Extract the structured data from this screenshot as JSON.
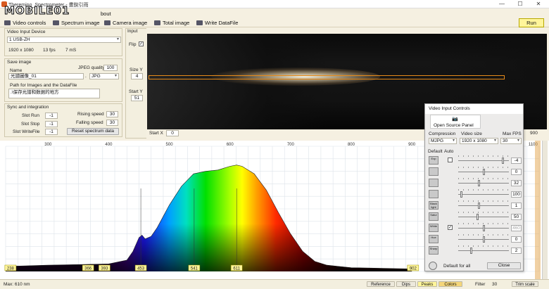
{
  "window": {
    "title": "Theremino_Spectrometer - 畫銳引雨",
    "logo": "MOBILE01",
    "menu_partial": "bout",
    "min": "—",
    "max": "☐",
    "close": "✕"
  },
  "toolbar": {
    "video_controls": "Video controls",
    "spectrum_image": "Spectrum image",
    "camera_image": "Camera image",
    "total_image": "Total image",
    "write_datafile": "Write DataFile",
    "run": "Run"
  },
  "video_input_device": {
    "header": "Video Input Device",
    "device": "1 USB-ZH",
    "resolution": "1920 x 1080",
    "fps": "13 fps",
    "ms": "7 mS"
  },
  "save_image": {
    "header": "Save image",
    "name_label": "Name",
    "jpeg_quality_label": "JPEG quality",
    "jpeg_quality": "100",
    "name_value": "光譜圖像_01",
    "dot": ".",
    "format": "JPG",
    "path_label": "Path for Images and the DataFile",
    "path_value": ".\\保存光譜和数据的地方"
  },
  "sync": {
    "header": "Sync and integration",
    "slot_run_label": "Slot Run",
    "slot_run": "-1",
    "slot_stop_label": "Slot Stop",
    "slot_stop": "-1",
    "slot_write_label": "Slot WriteFile",
    "slot_write": "-1",
    "rising_label": "Rising speed",
    "rising": "30",
    "falling_label": "Falling speed",
    "falling": "30",
    "reset_button": "Reset spectrum data"
  },
  "input": {
    "header": "Input",
    "flip_label": "Flip",
    "flip_checked": "✓",
    "size_y_label": "Size Y",
    "size_y": "4",
    "start_y_label": "Start Y",
    "start_y": "51",
    "start_x_label": "Start X",
    "start_x": "0",
    "right_value": "900"
  },
  "spectrum": {
    "x_ticks": [
      "300",
      "400",
      "500",
      "600",
      "700",
      "800",
      "900",
      "1100"
    ],
    "peak_labels": [
      "238",
      "366",
      "393",
      "453",
      "541",
      "611",
      "902"
    ]
  },
  "chart_data": {
    "type": "area",
    "x": [
      230,
      300,
      400,
      430,
      440,
      450,
      455,
      460,
      470,
      480,
      490,
      500,
      520,
      540,
      560,
      580,
      600,
      611,
      620,
      640,
      660,
      680,
      700,
      720,
      740,
      760,
      780,
      800,
      900
    ],
    "y": [
      0.04,
      0.05,
      0.06,
      0.09,
      0.16,
      0.27,
      0.29,
      0.26,
      0.28,
      0.35,
      0.44,
      0.53,
      0.68,
      0.78,
      0.8,
      0.81,
      0.84,
      0.85,
      0.84,
      0.78,
      0.65,
      0.47,
      0.3,
      0.16,
      0.08,
      0.05,
      0.04,
      0.03,
      0.02
    ],
    "xlim": [
      230,
      1110
    ],
    "ylim": [
      0,
      1
    ],
    "grid": true
  },
  "status": {
    "max": "Max: 610 nm",
    "reference": "Reference",
    "dips": "Dips",
    "peaks": "Peaks",
    "colors": "Colors",
    "filter_label": "Filter",
    "filter": "30",
    "trim_scale": "Trim scale"
  },
  "video_dialog": {
    "title": "Video Input Controls",
    "open_source_panel": "Open Source Panel",
    "compression_label": "Compression",
    "compression": "MJPG",
    "video_size_label": "Video size",
    "video_size": "1920 x 1080",
    "max_fps_label": "Max FPS",
    "max_fps": "30",
    "default_label": "Default",
    "auto_label": "Auto",
    "rows": [
      {
        "icon": "Exp",
        "value": "-4",
        "level": 0.9,
        "auto": ""
      },
      {
        "icon": "",
        "value": "0",
        "level": 0.5,
        "auto": ""
      },
      {
        "icon": "",
        "value": "32",
        "level": 0.4,
        "auto": ""
      },
      {
        "icon": "",
        "value": "100",
        "level": 0.05,
        "auto": ""
      },
      {
        "icon": "Black light",
        "value": "1",
        "level": 0.4,
        "auto": ""
      },
      {
        "icon": "Satur",
        "value": "50",
        "level": 0.38,
        "auto": ""
      },
      {
        "icon": "White",
        "value": "460",
        "level": 0.5,
        "auto": "✓"
      },
      {
        "icon": "Hue",
        "value": "0",
        "level": 0.5,
        "auto": ""
      },
      {
        "icon": "Sharp",
        "value": "2",
        "level": 0.25,
        "auto": ""
      }
    ],
    "default_for_all": "Default for all",
    "close": "Close"
  }
}
